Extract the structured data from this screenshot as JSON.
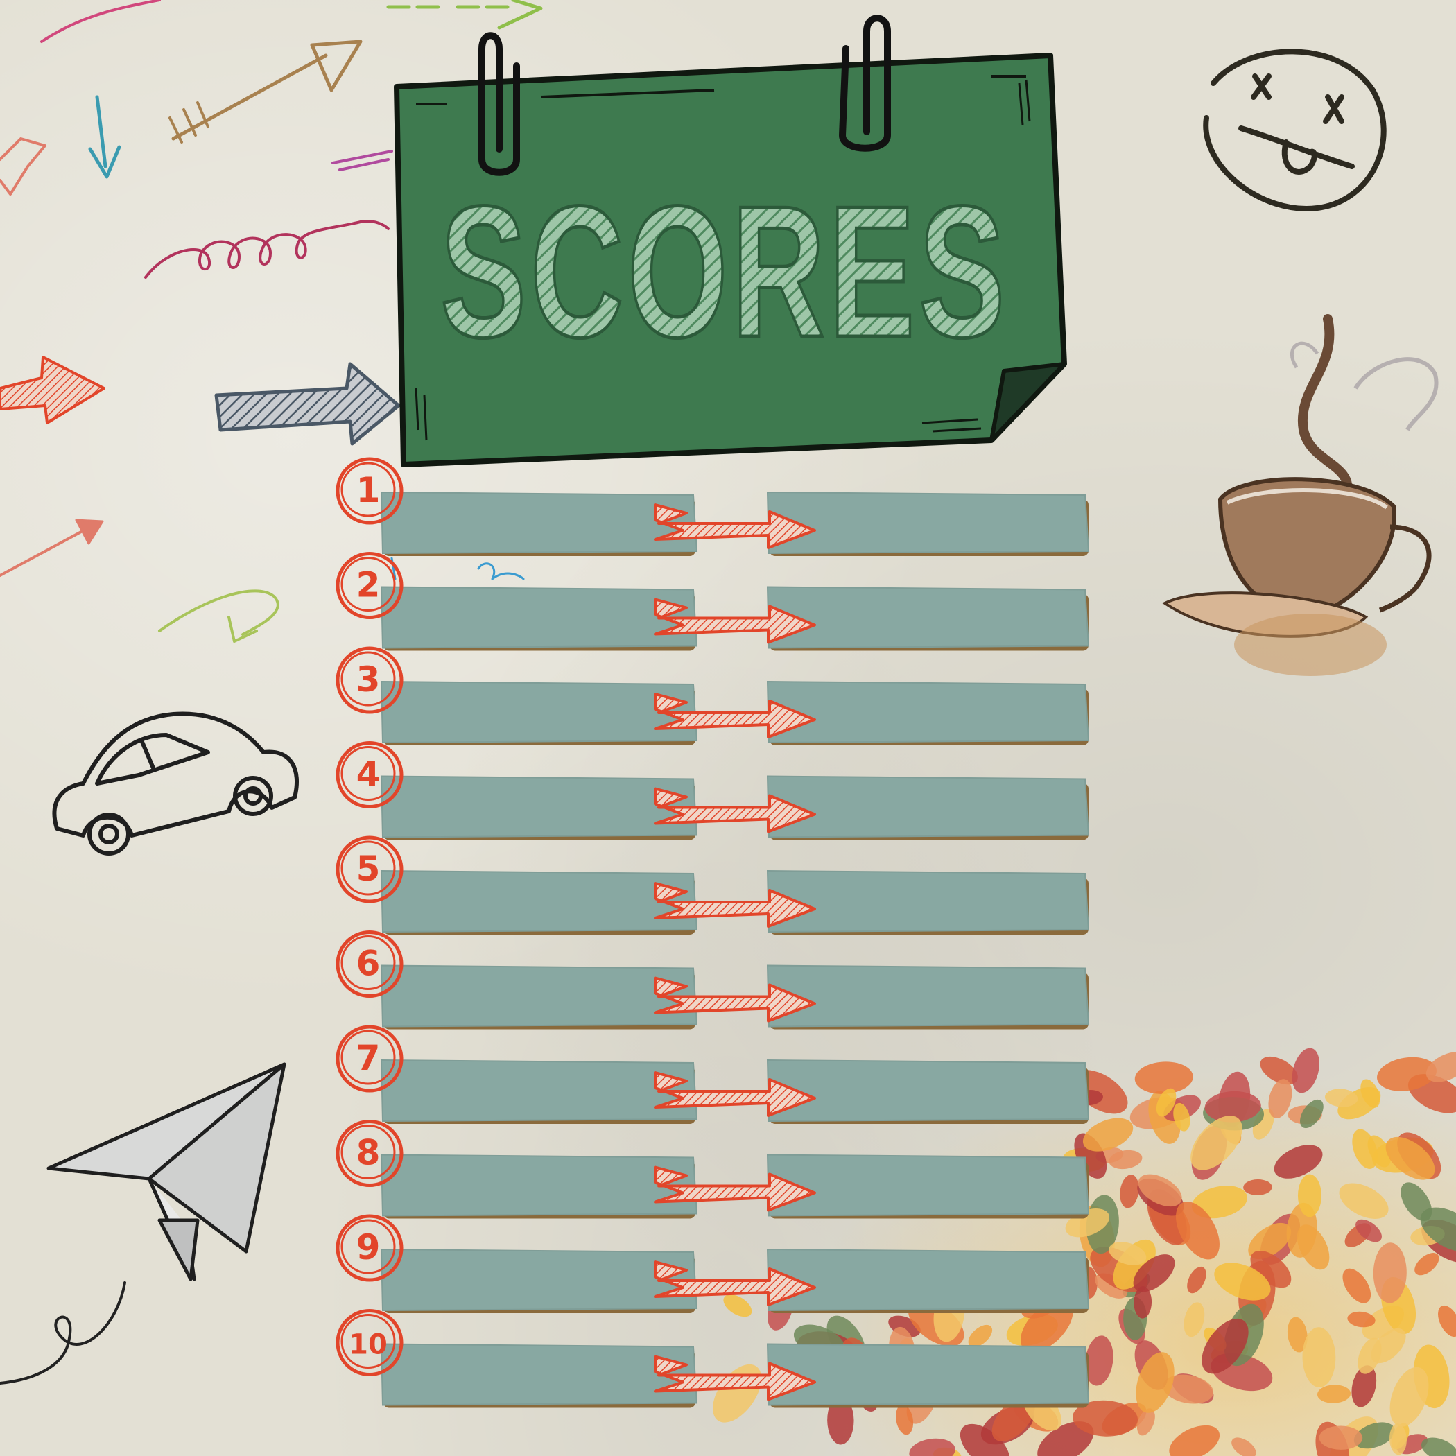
{
  "board": {
    "title": "SCORES",
    "rank_labels": [
      "1",
      "2",
      "3",
      "4",
      "5",
      "6",
      "7",
      "8",
      "9",
      "10"
    ]
  },
  "colors": {
    "board_green": "#3e7a4f",
    "title_fill": "#a9cdb2",
    "rank_red": "#e2452a",
    "slot_fill": "#88a8a2",
    "paper": "#e3e0d4"
  },
  "icons": [
    "paperclip-icon",
    "car-icon",
    "paper-plane-icon",
    "coffee-cup-icon",
    "dizzy-face-icon",
    "arrow-icon",
    "leaves-decoration"
  ]
}
